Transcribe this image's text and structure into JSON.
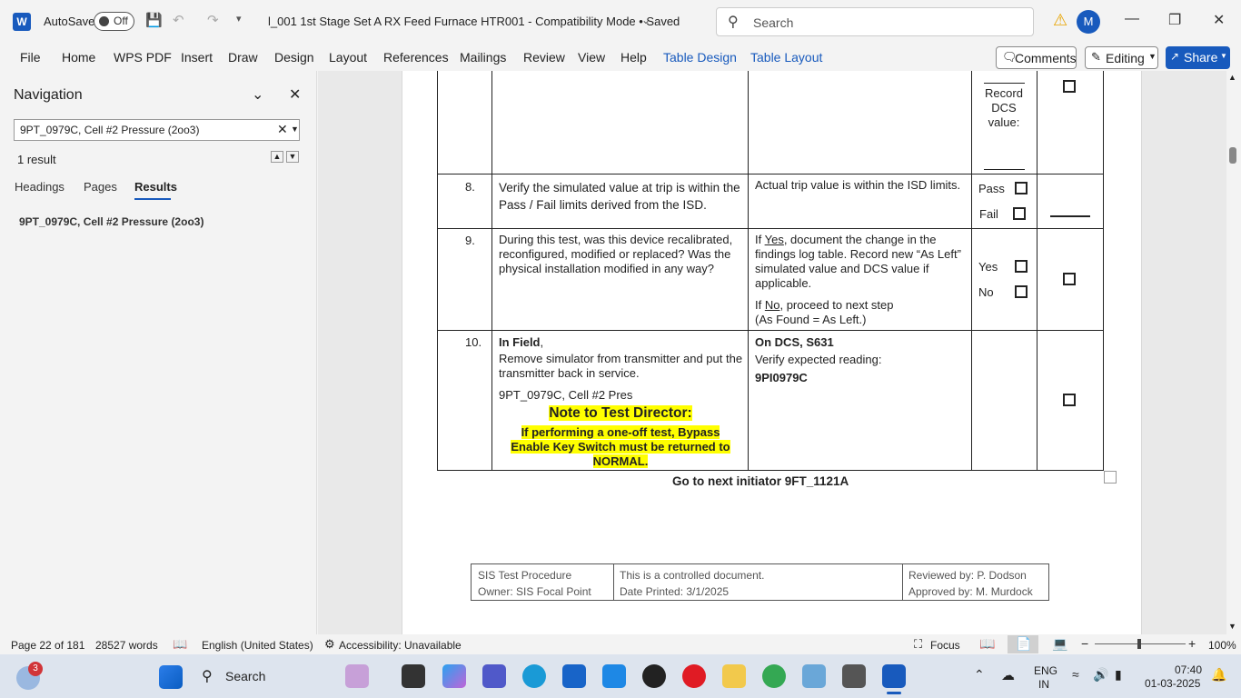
{
  "titlebar": {
    "app_letter": "W",
    "autosave_label": "AutoSave",
    "autosave_state": "Off",
    "doc_title": "l_001 1st Stage Set A RX Feed Furnace HTR001  -  Compatibility Mode  •  Saved",
    "search_placeholder": "Search",
    "avatar_initial": "M"
  },
  "ribbon": {
    "tabs": [
      "File",
      "Home",
      "WPS PDF",
      "Insert",
      "Draw",
      "Design",
      "Layout",
      "References",
      "Mailings",
      "Review",
      "View",
      "Help",
      "Table Design",
      "Table Layout"
    ],
    "comments": "Comments",
    "editing": "Editing",
    "share": "Share"
  },
  "navigation": {
    "title": "Navigation",
    "search_value": "9PT_0979C, Cell #2 Pressure (2oo3)",
    "result_count": "1 result",
    "tabs": [
      "Headings",
      "Pages",
      "Results"
    ],
    "result_item": "9PT_0979C, Cell #2 Pressure (2oo3)"
  },
  "table": {
    "row7": {
      "record_label": "Record DCS value:"
    },
    "row8": {
      "num": "8.",
      "action": "Verify the simulated value at trip is within the Pass / Fail limits derived from the ISD.",
      "expected": "Actual trip value is within the ISD limits.",
      "opt1": "Pass",
      "opt2": "Fail"
    },
    "row9": {
      "num": "9.",
      "action": "During this test, was this device recalibrated, reconfigured, modified or replaced?  Was the physical installation modified in any way?",
      "exp_if": "If ",
      "exp_yes": "Yes",
      "exp_rest": ", document the change in the findings log table.  Record new “As Left” simulated value and DCS value if applicable.",
      "exp2_if": "If ",
      "exp2_no": "No",
      "exp2_rest": ", proceed to next step",
      "exp3": "(As Found = As Left.)",
      "opt1": "Yes",
      "opt2": "No"
    },
    "row10": {
      "num": "10.",
      "in_field": "In Field",
      "comma": ",",
      "action": "Remove simulator from transmitter and put the transmitter back in service.",
      "tag": "9PT_0979C, Cell #2 Pres",
      "note_title": "Note to Test Director:",
      "note_body": "If performing a one-off test, Bypass Enable Key Switch must be returned to NORMAL.",
      "on_dcs": "On DCS, S631",
      "verify": "Verify expected reading:",
      "tag2": "9PI0979C"
    },
    "goto": "Go to next initiator 9FT_1121A"
  },
  "footer": {
    "col1_line1": "SIS Test Procedure",
    "col1_line2": "Owner: SIS Focal Point",
    "col2_line1": "This is a controlled document.",
    "col2_line2": "Date Printed: 3/1/2025",
    "col3_line1": "Reviewed by: P. Dodson",
    "col3_line2": "Approved by: M. Murdock"
  },
  "status": {
    "page": "Page 22 of 181",
    "words": "28527 words",
    "language": "English (United States)",
    "accessibility": "Accessibility: Unavailable",
    "focus": "Focus",
    "zoom": "100%"
  },
  "taskbar": {
    "search": "Search",
    "badge": "3",
    "lang1": "ENG",
    "lang2": "IN",
    "time": "07:40",
    "date": "01-03-2025"
  }
}
